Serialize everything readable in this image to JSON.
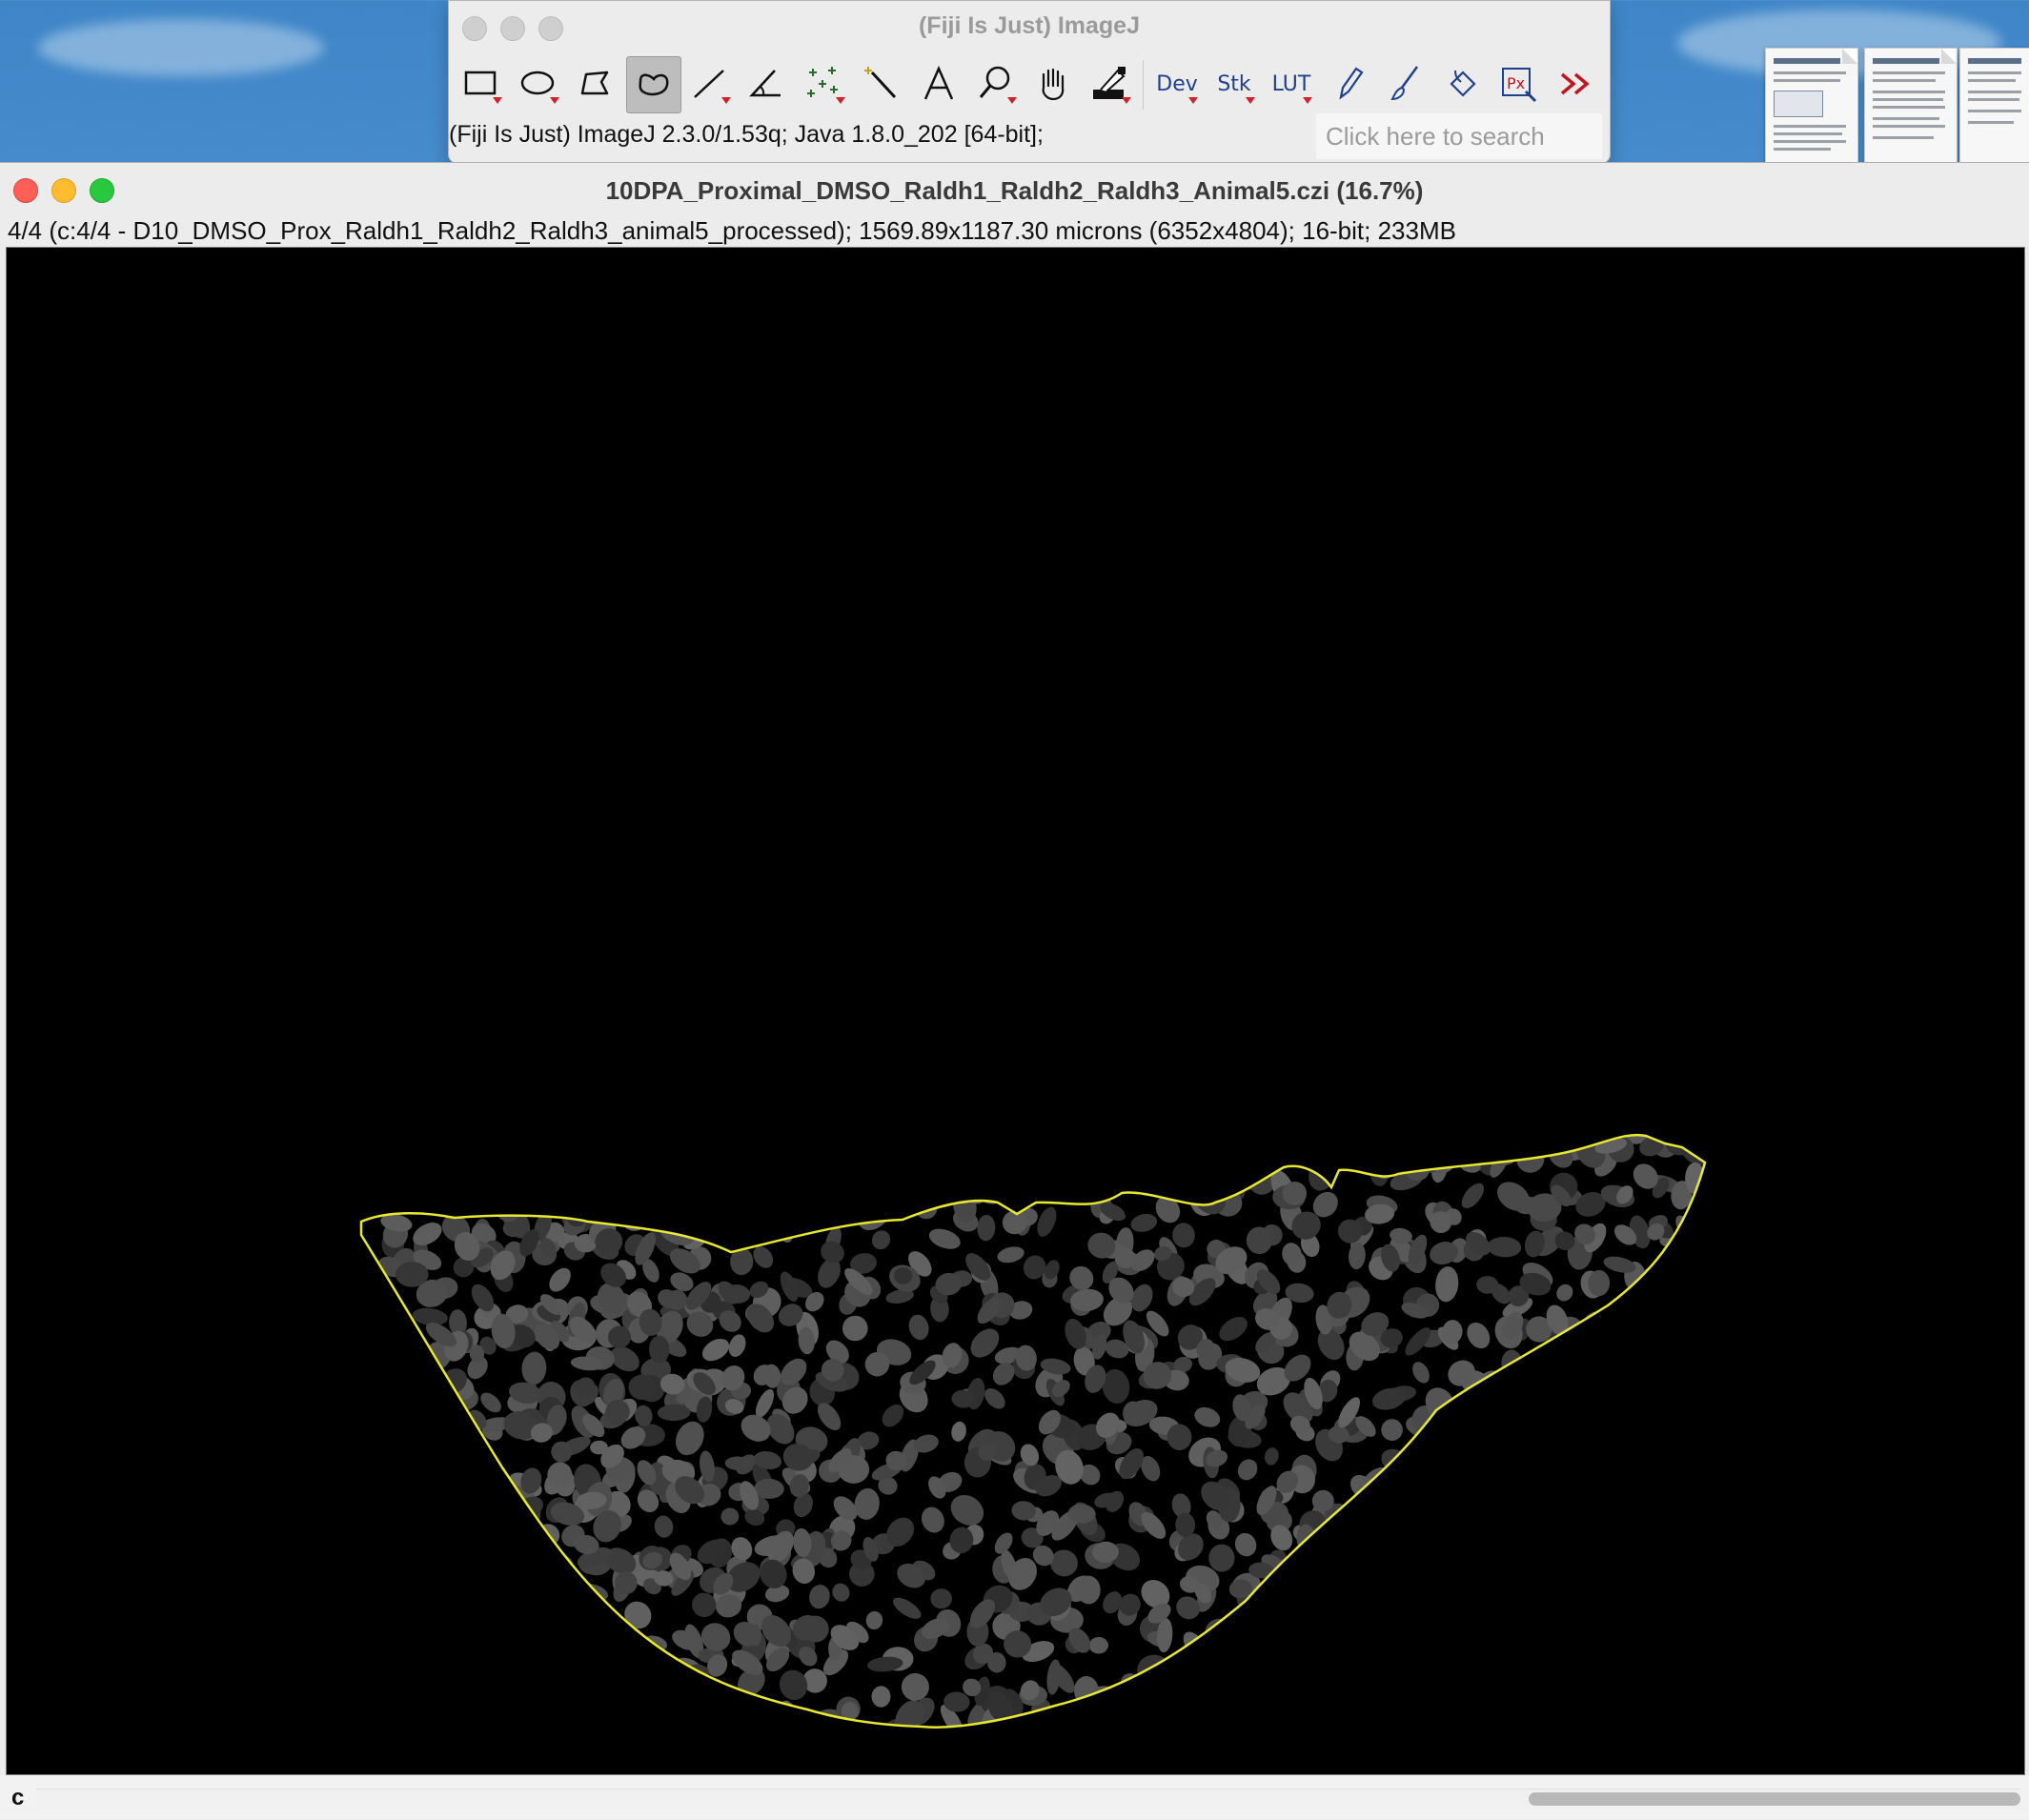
{
  "fiji_toolbar": {
    "title": "(Fiji Is Just) ImageJ",
    "status": "(Fiji Is Just) ImageJ 2.3.0/1.53q; Java 1.8.0_202 [64-bit];",
    "search_placeholder": "Click here to search",
    "active_tool": "freehand-selection",
    "tools": [
      {
        "name": "rectangle-tool-icon",
        "has_menu": true
      },
      {
        "name": "oval-tool-icon",
        "has_menu": true
      },
      {
        "name": "polygon-tool-icon",
        "has_menu": false
      },
      {
        "name": "freehand-tool-icon",
        "has_menu": false
      },
      {
        "name": "line-tool-icon",
        "has_menu": true
      },
      {
        "name": "angle-tool-icon",
        "has_menu": false
      },
      {
        "name": "multipoint-tool-icon",
        "has_menu": true
      },
      {
        "name": "wand-tool-icon",
        "has_menu": false
      },
      {
        "name": "text-tool-icon",
        "has_menu": false
      },
      {
        "name": "magnifier-tool-icon",
        "has_menu": true
      },
      {
        "name": "hand-tool-icon",
        "has_menu": false
      },
      {
        "name": "color-picker-icon",
        "has_menu": true
      },
      {
        "name": "dev-menu-icon",
        "label": "Dev",
        "has_menu": true
      },
      {
        "name": "stk-menu-icon",
        "label": "Stk",
        "has_menu": true
      },
      {
        "name": "lut-menu-icon",
        "label": "LUT",
        "has_menu": true
      },
      {
        "name": "pencil-tool-icon",
        "has_menu": false
      },
      {
        "name": "brush-tool-icon",
        "has_menu": false
      },
      {
        "name": "flood-fill-icon",
        "has_menu": false
      },
      {
        "name": "pixel-inspector-icon",
        "label": "Px",
        "has_menu": false
      },
      {
        "name": "more-tools-icon",
        "has_menu": false
      }
    ]
  },
  "image_window": {
    "title": "10DPA_Proximal_DMSO_Raldh1_Raldh2_Raldh3_Animal5.czi (16.7%)",
    "info": "4/4 (c:4/4 - D10_DMSO_Prox_Raldh1_Raldh2_Raldh3_animal5_processed); 1569.89x1187.30 microns (6352x4804); 16-bit; 233MB",
    "channel_slider_label": "c",
    "roi_color": "#e8e830",
    "background_color": "#000000"
  },
  "colors": {
    "lut_label": "#1f3f8f",
    "menu_caret": "#d0202a",
    "more_tools": "#c0141e"
  }
}
